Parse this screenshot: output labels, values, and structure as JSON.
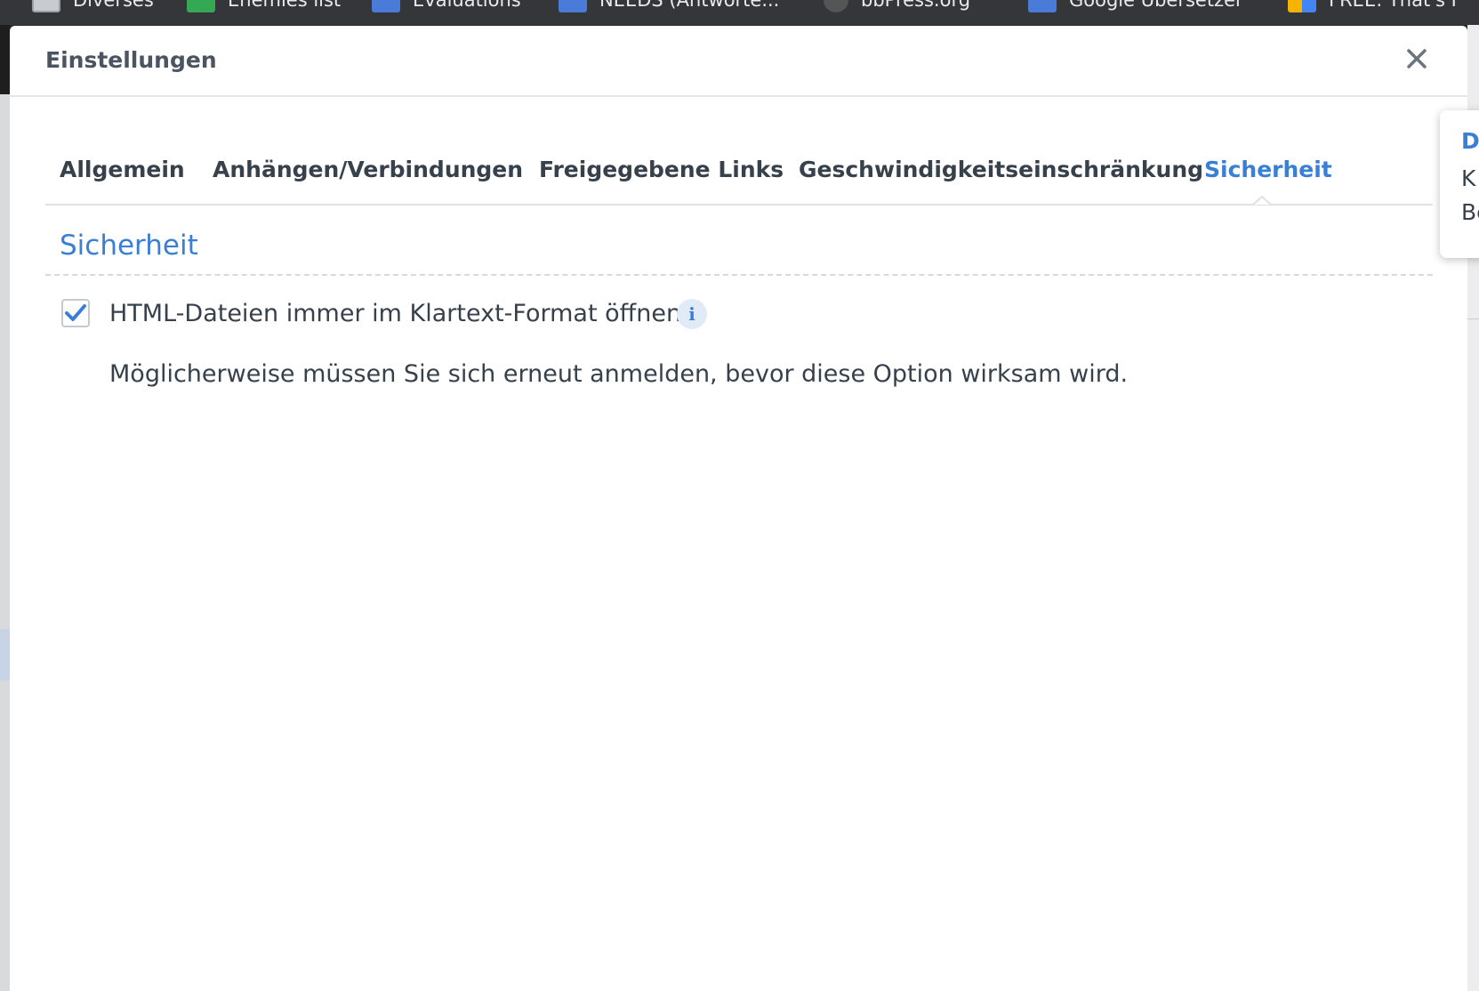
{
  "browser": {
    "bookmarks": [
      {
        "label": "Diverses",
        "icon": "folder-icon",
        "color": "#c8cbd0"
      },
      {
        "label": "Enemies list",
        "icon": "sheets-icon",
        "color": "#34a853"
      },
      {
        "label": "Evaluations",
        "icon": "forms-icon",
        "color": "#4a7bd9"
      },
      {
        "label": "NEEDS (Antworte...",
        "icon": "forms-icon",
        "color": "#4a7bd9"
      },
      {
        "label": "bbPress.org",
        "icon": "bbpress-icon",
        "color": "#555555"
      },
      {
        "label": "Google Übersetzer",
        "icon": "translate-icon",
        "color": "#4a7bd9"
      },
      {
        "label": "FREE: That's I",
        "icon": "folder-colored-icon",
        "color": "#f4b400"
      }
    ]
  },
  "dialog": {
    "title": "Einstellungen",
    "close_icon": "close-icon",
    "tabs": [
      {
        "label": "Allgemein",
        "active": false
      },
      {
        "label": "Anhängen/Verbindungen",
        "active": false
      },
      {
        "label": "Freigegebene Links",
        "active": false
      },
      {
        "label": "Geschwindigkeitseinschränkung",
        "active": false
      },
      {
        "label": "Sicherheit",
        "active": true
      }
    ],
    "section": {
      "title": "Sicherheit",
      "option": {
        "label": "HTML-Dateien immer im Klartext-Format öffnen",
        "checked": true,
        "info_icon": "i"
      },
      "hint": "Möglicherweise müssen Sie sich erneut anmelden, bevor diese Option wirksam wird."
    }
  },
  "popup": {
    "title": "D",
    "lines": [
      "K",
      "Be"
    ]
  },
  "colors": {
    "accent": "#3a7fd6",
    "text": "#37414b",
    "title": "#4a5561"
  }
}
